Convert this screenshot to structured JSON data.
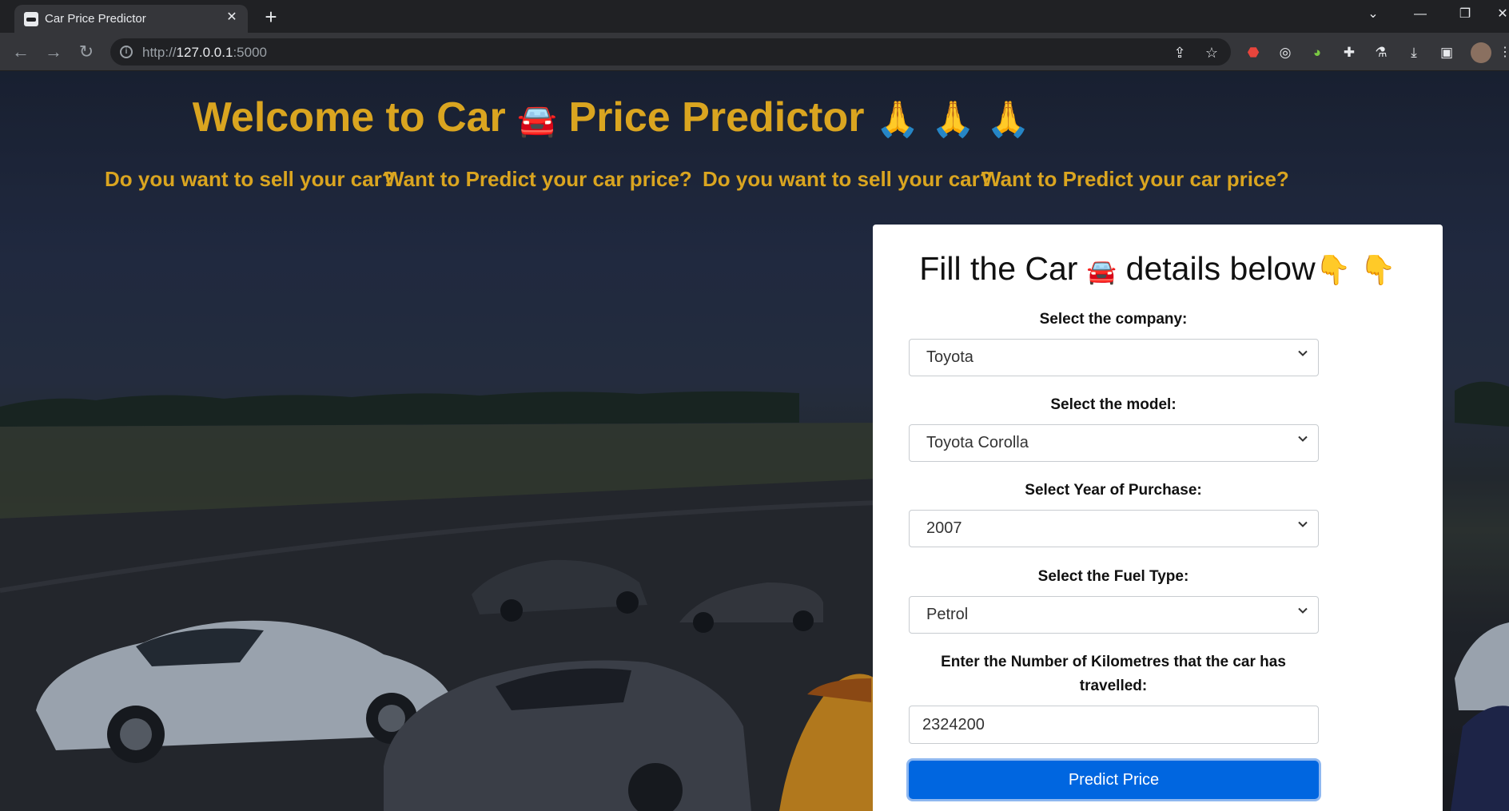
{
  "browser": {
    "tab_title": "Car Price Predictor",
    "tab_close": "✕",
    "new_tab": "+",
    "url_scheme": "http://",
    "url_host": "127.0.0.1",
    "url_port": ":5000",
    "window_controls": {
      "dropdown": "⌄",
      "minimize": "—",
      "restore": "❐",
      "close": "✕"
    }
  },
  "page": {
    "title_part1": "Welcome to Car",
    "car_emoji": "🚘",
    "title_part2": "Price Predictor",
    "praying_emoji": "🙏",
    "tagline_1": "Do you want to sell your car?",
    "tagline_2": "Want to Predict your car price?",
    "tagline_3": "Do you want to sell your car?",
    "tagline_4": "Want to Predict your car price?"
  },
  "form": {
    "title_part1": "Fill the Car",
    "title_car_emoji": "🚘",
    "title_part2": "details below",
    "pointing_emoji": "👇",
    "company_label": "Select the company:",
    "company_value": "Toyota",
    "model_label": "Select the model:",
    "model_value": "Toyota Corolla",
    "year_label": "Select Year of Purchase:",
    "year_value": "2007",
    "fuel_label": "Select the Fuel Type:",
    "fuel_value": "Petrol",
    "km_label_line1": "Enter the Number of Kilometres that the car has",
    "km_label_line2": "travelled:",
    "km_value": "2324200",
    "submit_label": "Predict Price"
  },
  "colors": {
    "heading_gold": "#daa520",
    "button_blue": "#0066e0",
    "chrome_dark": "#202124",
    "chrome_toolbar": "#35363a"
  }
}
